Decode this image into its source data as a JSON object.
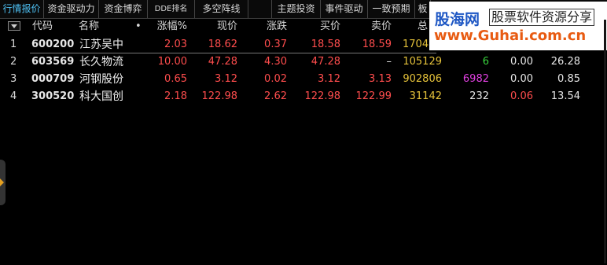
{
  "tabs": [
    {
      "label": "行情报价",
      "active": true
    },
    {
      "label": "资金驱动力",
      "active": false
    },
    {
      "label": "资金博弈",
      "active": false
    },
    {
      "label": "DDE排名",
      "active": false
    },
    {
      "label": "多空阵线",
      "active": false
    },
    {
      "label": "主题投资",
      "active": false
    },
    {
      "label": "事件驱动",
      "active": false
    },
    {
      "label": "一致预期",
      "active": false
    },
    {
      "label": "板",
      "active": false
    }
  ],
  "columns": {
    "code": "代码",
    "name": "名称",
    "name_dot": "•",
    "change_pct": "涨幅%",
    "price": "现价",
    "change": "涨跌",
    "bid": "买价",
    "ask": "卖价",
    "total_partial": "总"
  },
  "rows": [
    {
      "index": "1",
      "code": "600200",
      "name": "江苏吴中",
      "change_pct": "2.03",
      "price": "18.62",
      "change": "0.37",
      "bid": "18.58",
      "ask": "18.59",
      "volume": "1704",
      "now": "",
      "speed": "",
      "turnover": ""
    },
    {
      "index": "2",
      "code": "603569",
      "name": "长久物流",
      "change_pct": "10.00",
      "price": "47.28",
      "change": "4.30",
      "bid": "47.28",
      "ask": "–",
      "volume": "105129",
      "now": "6",
      "speed": "0.00",
      "turnover": "26.28"
    },
    {
      "index": "3",
      "code": "000709",
      "name": "河钢股份",
      "change_pct": "0.65",
      "price": "3.12",
      "change": "0.02",
      "bid": "3.12",
      "ask": "3.13",
      "volume": "902806",
      "now": "6982",
      "speed": "0.00",
      "turnover": "0.85"
    },
    {
      "index": "4",
      "code": "300520",
      "name": "科大国创",
      "change_pct": "2.18",
      "price": "122.98",
      "change": "2.62",
      "bid": "122.98",
      "ask": "122.99",
      "volume": "31142",
      "now": "232",
      "speed": "0.06",
      "turnover": "13.54"
    }
  ],
  "watermark": {
    "brand": "股海网",
    "tagline": "股票软件资源分享",
    "url": "www.Guhai.com.cn"
  },
  "colors": {
    "up": "#ff4d4d",
    "volume": "#e5c23a",
    "active_tab": "#4fc3f7",
    "background": "#000000"
  }
}
